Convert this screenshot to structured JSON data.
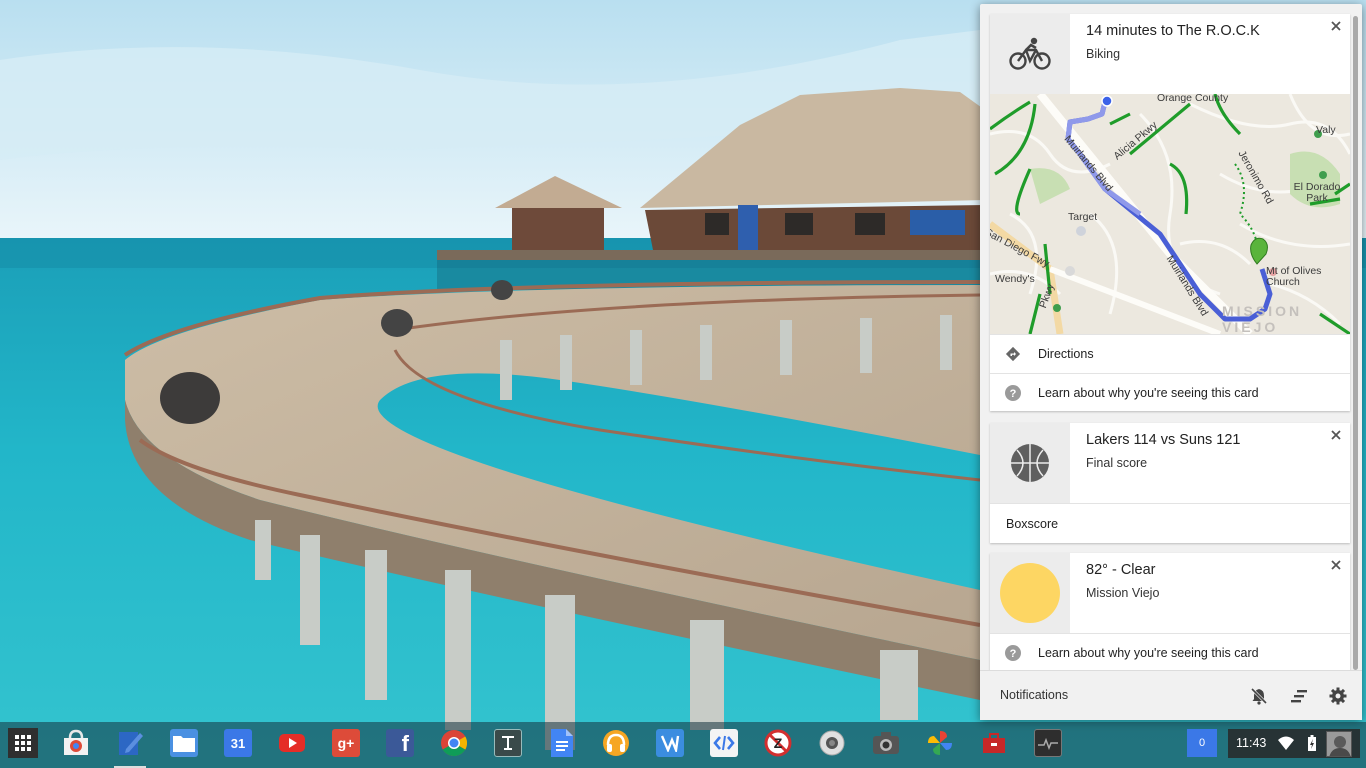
{
  "colors": {
    "accent_blue": "#3b78e7",
    "route_blue": "#4a5fd6",
    "map_green": "#1f9c2a",
    "weather_sun": "#fdd663"
  },
  "cards": [
    {
      "title": "14 minutes to The R.O.C.K",
      "subtitle": "Biking",
      "icon": "bicycle-icon",
      "map_labels": {
        "orange_county": "Orange County",
        "valy": "Valy",
        "alicia_pkwy": "Alicia Pkwy",
        "muirlands_blvd_top": "Muirlands Blvd",
        "jeronimo_rd": "Jeronimo Rd",
        "el_dorado_park": "El Dorado Park",
        "target": "Target",
        "san_diego_fwy": "San Diego Fwy",
        "wendys": "Wendy's",
        "muirlands_blvd_bottom": "Muirlands Blvd",
        "mt_of_olives": "Mt of Olives Church",
        "pkwy": "Pkwy",
        "mission_viejo": "MISSION VIEJO"
      },
      "actions": [
        {
          "label": "Directions",
          "icon": "directions-icon"
        },
        {
          "label": "Learn about why you're seeing this card",
          "icon": "help-icon"
        }
      ]
    },
    {
      "title": "Lakers 114 vs Suns 121",
      "subtitle": "Final score",
      "icon": "basketball-icon",
      "actions": [
        {
          "label": "Boxscore"
        }
      ]
    },
    {
      "title": "82° - Clear",
      "subtitle": "Mission Viejo",
      "icon": "sun-icon",
      "actions": [
        {
          "label": "Learn about why you're seeing this card",
          "icon": "help-icon"
        }
      ]
    }
  ],
  "footer": {
    "label": "Notifications",
    "buttons": [
      "do-not-disturb-icon",
      "clear-all-icon",
      "settings-gear-icon"
    ]
  },
  "shelf": {
    "apps": [
      "web-store",
      "notes",
      "files",
      "calendar",
      "youtube",
      "google-plus",
      "facebook",
      "chrome",
      "text-editor",
      "docs",
      "music",
      "tweetdeck",
      "code-editor",
      "block-app",
      "camera",
      "screenshot",
      "photos",
      "toolbox",
      "monitor"
    ],
    "calendar_day": "31",
    "google_plus_text": "g+",
    "facebook_text": "f"
  },
  "tray": {
    "notification_count": "0",
    "time": "11:43"
  }
}
